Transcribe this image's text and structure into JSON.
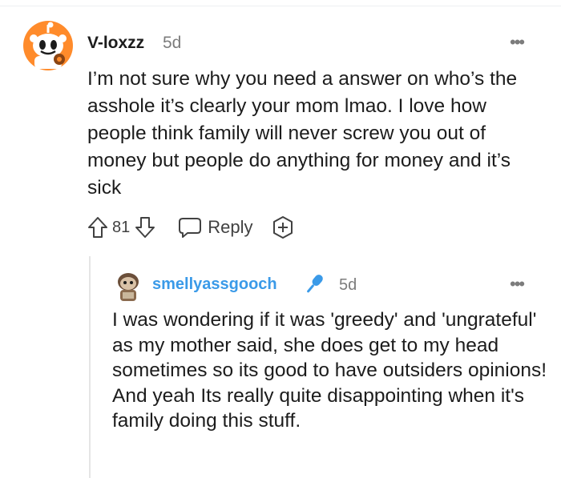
{
  "comment": {
    "author": "V-loxzz",
    "age": "5d",
    "more_label": "•••",
    "body": "I’m not sure why you need a answer on who’s the asshole it’s clearly your mom lmao. I love how people think family will never screw you out of money but people do anything for money and it’s sick",
    "score": "81",
    "reply_label": "Reply",
    "icons": {
      "upvote": "arrow-up-icon",
      "downvote": "arrow-down-icon",
      "reply": "speech-bubble-icon",
      "award": "plus-circle-icon",
      "more": "ellipsis-icon"
    }
  },
  "reply": {
    "author": "smellyassgooch",
    "author_color": "#3a9ae8",
    "flair_icon": "microphone-icon",
    "age": "5d",
    "more_label": "•••",
    "body": "I was wondering if it was 'greedy' and 'ungrateful' as my mother said, she does get to my head sometimes so its good to have outsiders opinions! And yeah Its really quite disappointing when it's family doing this stuff."
  },
  "colors": {
    "text": "#1c1c1c",
    "meta": "#7c7c7c",
    "avatar_bg": "#ff8b2b",
    "thread_line": "#e5e5e5"
  }
}
